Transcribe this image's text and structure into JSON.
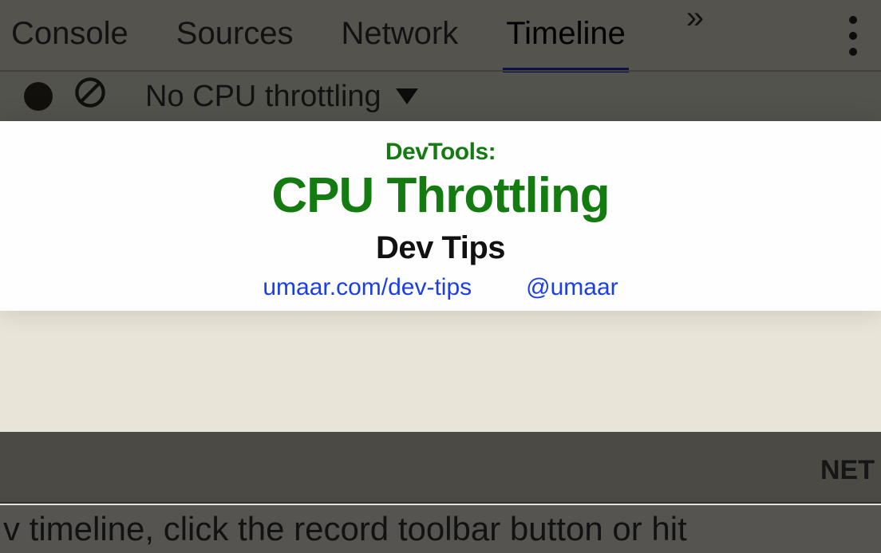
{
  "tabs": {
    "console": "Console",
    "sources": "Sources",
    "network": "Network",
    "timeline": "Timeline",
    "more": "»"
  },
  "toolbar": {
    "throttling_label": "No CPU throttling"
  },
  "card": {
    "pretitle": "DevTools:",
    "title": "CPU Throttling",
    "subtitle": "Dev Tips",
    "link_site": "umaar.com/dev-tips",
    "link_handle": "@umaar"
  },
  "bottom": {
    "right_label": "NET"
  },
  "hint": {
    "text": "v timeline, click the record toolbar button or hit"
  }
}
